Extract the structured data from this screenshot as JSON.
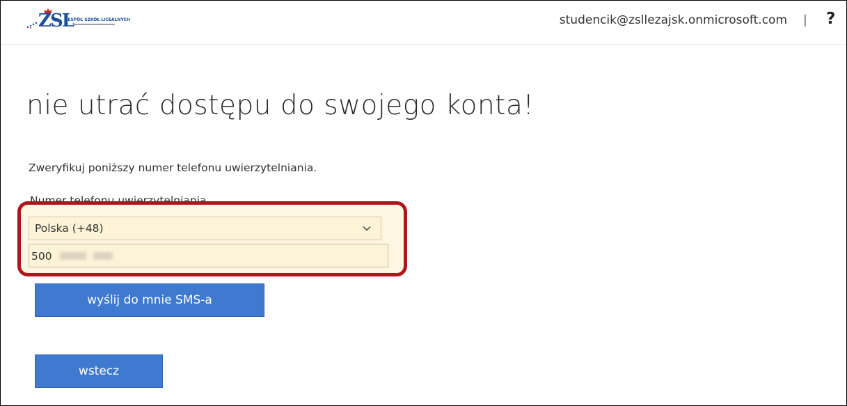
{
  "header": {
    "logo_main": "ZSL",
    "logo_title": "ZESPÓŁ SZKÓŁ LICEALNYCH",
    "account_email": "studencik@zsllezajsk.onmicrosoft.com",
    "separator": "|",
    "help_label": "?"
  },
  "main": {
    "title": "nie utrać dostępu do swojego konta!",
    "description": "Zweryfikuj poniższy numer telefonu uwierzytelniania.",
    "field_label": "Numer telefonu uwierzytelniania",
    "country_select": {
      "selected": "Polska (+48)"
    },
    "phone_input": {
      "value": "500"
    },
    "send_sms_button": "wyślij do mnie SMS-a",
    "back_button": "wstecz"
  },
  "colors": {
    "accent_button": "#3f7ad0",
    "highlight_border": "#b0151b",
    "field_background": "#fdf3d8",
    "logo_blue": "#1d4f9c"
  },
  "icons": {
    "logo": "school-logo",
    "select_chevron": "chevron-down-icon",
    "help": "question-mark-icon"
  }
}
